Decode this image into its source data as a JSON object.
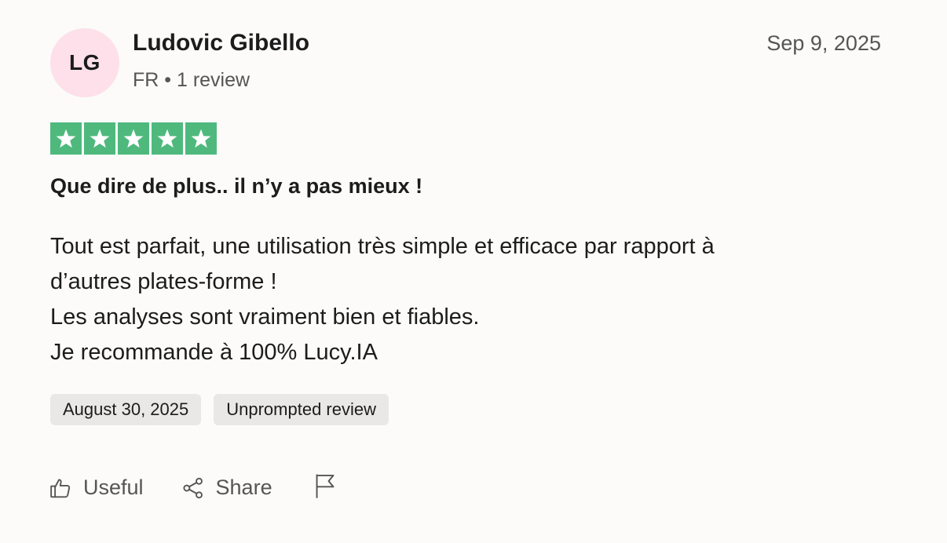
{
  "reviewer": {
    "initials": "LG",
    "name": "Ludovic Gibello",
    "meta": "FR • 1 review"
  },
  "review": {
    "posted_date": "Sep 9, 2025",
    "rating": 5,
    "title": "Que dire de plus.. il n’y a pas mieux !",
    "body_lines": [
      "Tout est parfait, une utilisation très simple et efficace par rapport à",
      "d’autres plates-forme !",
      "Les analyses sont vraiment bien et fiables.",
      "Je recommande à 100% Lucy.IA"
    ],
    "tags": {
      "experience_date": "August 30, 2025",
      "type": "Unprompted review"
    }
  },
  "actions": {
    "useful_label": "Useful",
    "share_label": "Share"
  },
  "colors": {
    "star_green": "#4fb97d",
    "avatar_bg": "#fde0ea",
    "tag_bg": "#e9e8e6"
  },
  "icons": {
    "star": "star-icon",
    "useful": "thumbs-up-icon",
    "share": "share-icon",
    "report": "flag-icon"
  }
}
